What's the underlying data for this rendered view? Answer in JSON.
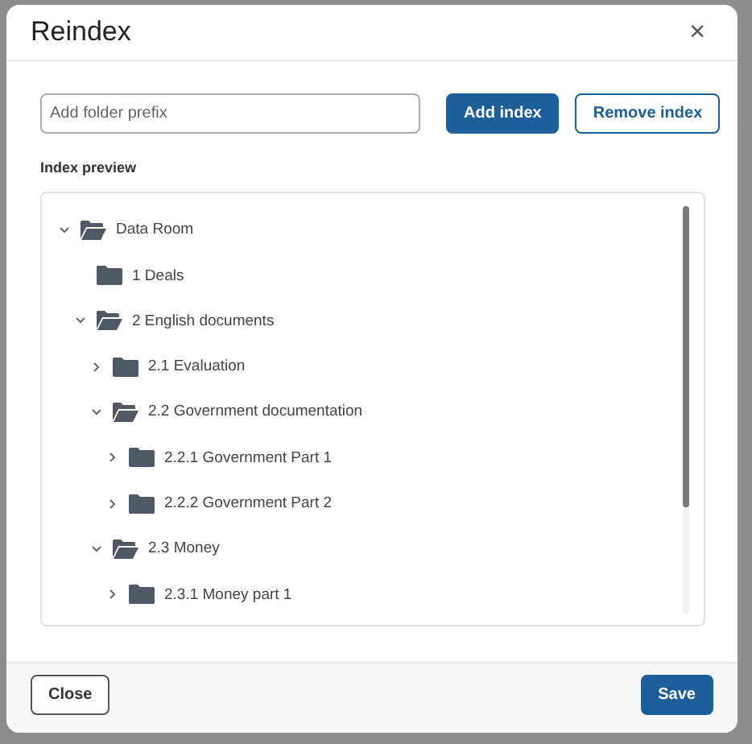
{
  "dialog": {
    "title": "Reindex",
    "close_icon": "×"
  },
  "prefix_field": {
    "placeholder": "Add folder prefix"
  },
  "buttons": {
    "add": "Add index",
    "remove": "Remove index"
  },
  "preview_label": "Index preview",
  "tree": [
    {
      "label": "Data Room",
      "kind": "branch",
      "expanded": true,
      "children": [
        {
          "label": "1 Deals",
          "kind": "leaf",
          "expanded": false
        },
        {
          "label": "2 English documents",
          "kind": "branch",
          "expanded": true,
          "children": [
            {
              "label": "2.1 Evaluation",
              "kind": "branch",
              "expanded": false
            },
            {
              "label": "2.2 Government documentation",
              "kind": "branch",
              "expanded": true,
              "children": [
                {
                  "label": "2.2.1 Government Part 1",
                  "kind": "branch",
                  "expanded": false
                },
                {
                  "label": "2.2.2 Government Part 2",
                  "kind": "branch",
                  "expanded": false
                }
              ]
            },
            {
              "label": "2.3 Money",
              "kind": "branch",
              "expanded": true,
              "children": [
                {
                  "label": "2.3.1 Money part 1",
                  "kind": "branch",
                  "expanded": false
                }
              ]
            }
          ]
        }
      ]
    }
  ],
  "footer": {
    "close": "Close",
    "save": "Save"
  }
}
